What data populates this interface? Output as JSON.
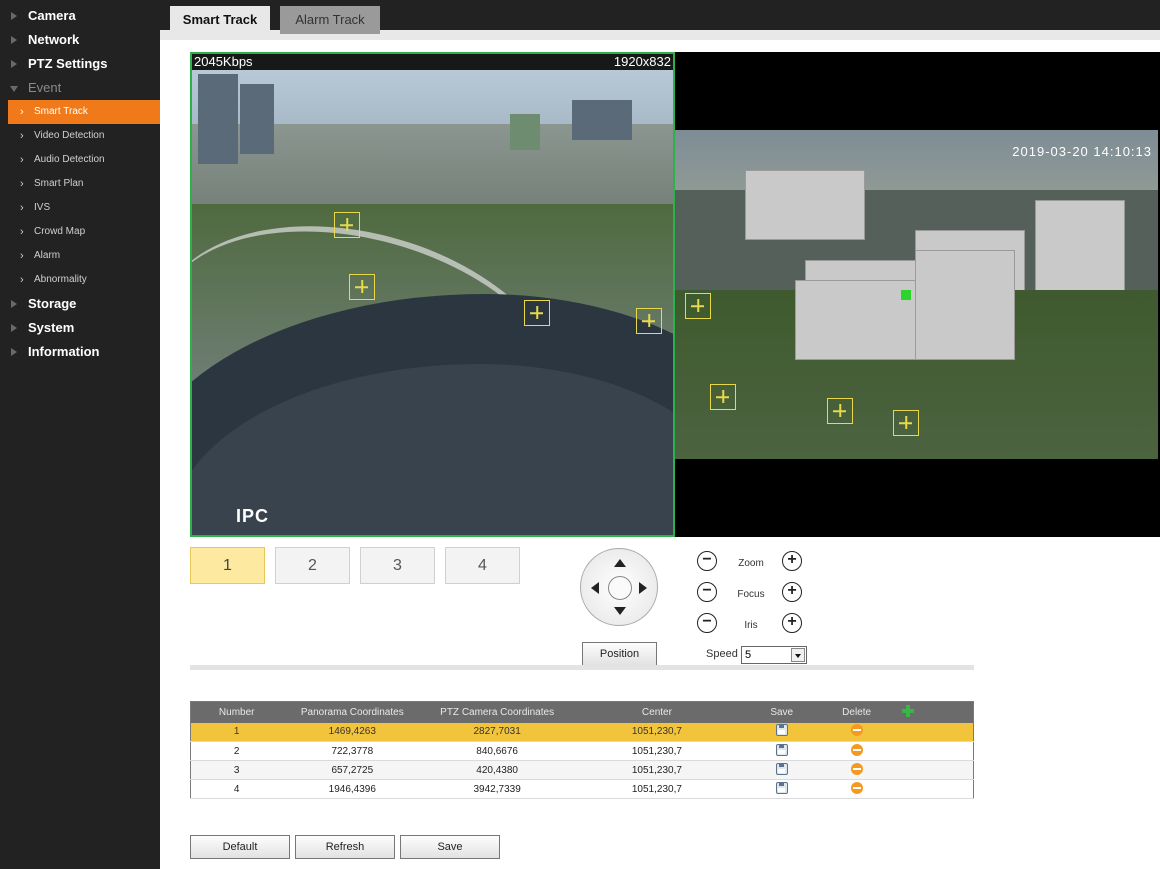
{
  "sidebar": {
    "items": [
      {
        "label": "Camera",
        "type": "main"
      },
      {
        "label": "Network",
        "type": "main"
      },
      {
        "label": "PTZ Settings",
        "type": "main"
      },
      {
        "label": "Event",
        "type": "main-open"
      },
      {
        "label": "Smart Track",
        "type": "sub-active"
      },
      {
        "label": "Video Detection",
        "type": "sub"
      },
      {
        "label": "Audio Detection",
        "type": "sub"
      },
      {
        "label": "Smart Plan",
        "type": "sub"
      },
      {
        "label": "IVS",
        "type": "sub"
      },
      {
        "label": "Crowd Map",
        "type": "sub"
      },
      {
        "label": "Alarm",
        "type": "sub"
      },
      {
        "label": "Abnormality",
        "type": "sub"
      },
      {
        "label": "Storage",
        "type": "main"
      },
      {
        "label": "System",
        "type": "main"
      },
      {
        "label": "Information",
        "type": "main"
      }
    ]
  },
  "tabs": {
    "active": "Smart Track",
    "inactive": "Alarm Track"
  },
  "video": {
    "bitrate": "2045Kbps",
    "resolution": "1920x832",
    "watermark": "IPC",
    "timestamp": "2019-03-20 14:10:13"
  },
  "presets": [
    "1",
    "2",
    "3",
    "4"
  ],
  "controls": {
    "zoom": "Zoom",
    "focus": "Focus",
    "iris": "Iris",
    "minus": "−",
    "plus": "+",
    "position_button": "Position",
    "speed_label": "Speed",
    "speed_value": "5"
  },
  "table": {
    "headers": [
      "Number",
      "Panorama Coordinates",
      "PTZ Camera Coordinates",
      "Center",
      "Save",
      "Delete"
    ],
    "rows": [
      {
        "number": "1",
        "panorama": "1469,4263",
        "ptz": "2827,7031",
        "center": "1051,230,7"
      },
      {
        "number": "2",
        "panorama": "722,3778",
        "ptz": "840,6676",
        "center": "1051,230,7"
      },
      {
        "number": "3",
        "panorama": "657,2725",
        "ptz": "420,4380",
        "center": "1051,230,7"
      },
      {
        "number": "4",
        "panorama": "1946,4396",
        "ptz": "3942,7339",
        "center": "1051,230,7"
      }
    ]
  },
  "buttons": {
    "default": "Default",
    "refresh": "Refresh",
    "save": "Save"
  },
  "colors": {
    "sidebar_bg": "#222222",
    "active_nav": "#f07a1a",
    "selected_row": "#f2c43c",
    "preset_active": "#fde9a0",
    "panorama_border": "#2bb24c"
  }
}
